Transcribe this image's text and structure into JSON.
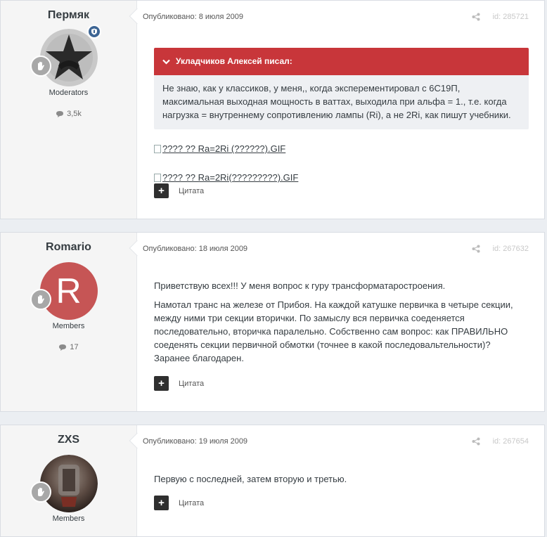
{
  "posts": [
    {
      "author": "Пермяк",
      "group": "Moderators",
      "post_count": "3,5k",
      "date": "Опубликовано: 8 июля 2009",
      "post_id": "id: 285721",
      "quote": {
        "author": "Укладчиков Алексей писал:",
        "text": "Не знаю, как у классиков, у меня,, когда эксперементировал с 6С19П, максимальная выходная мощность в ваттах, выходила при альфа = 1., т.е. когда нагрузка = внутреннему сопротивлению лампы (Ri), а не 2Ri, как пишут учебники."
      },
      "images": [
        "???? ?? Ra=2Ri (??????).GIF",
        "???? ?? Ra=2Ri(?????????).GIF"
      ],
      "quote_label": "Цитата"
    },
    {
      "author": "Romario",
      "avatar_letter": "R",
      "group": "Members",
      "post_count": "17",
      "date": "Опубликовано: 18 июля 2009",
      "post_id": "id: 267632",
      "paragraphs": [
        "Приветствую всех!!! У меня вопрос к гуру трансформатаростроения.",
        "Намотал транс на железе от Прибоя. На каждой катушке первичка в четыре секции, между ними три секции вторички. По замыслу вся первичка соеденяется последовательно, вторичка паралельно. Собственно сам вопрос: как ПРАВИЛЬНО соеденять секции первичной обмотки (точнее в какой последовальтельности)? Заранее благодарен."
      ],
      "quote_label": "Цитата"
    },
    {
      "author": "ZXS",
      "group": "Members",
      "date": "Опубликовано: 19 июля 2009",
      "post_id": "id: 267654",
      "paragraphs": [
        "Первую с последней, затем вторую и третью."
      ],
      "quote_label": "Цитата"
    }
  ],
  "colors": {
    "quote_header": "#c8363a",
    "avatar_romario": "#c65555",
    "moderator_badge": "#3d6594"
  }
}
